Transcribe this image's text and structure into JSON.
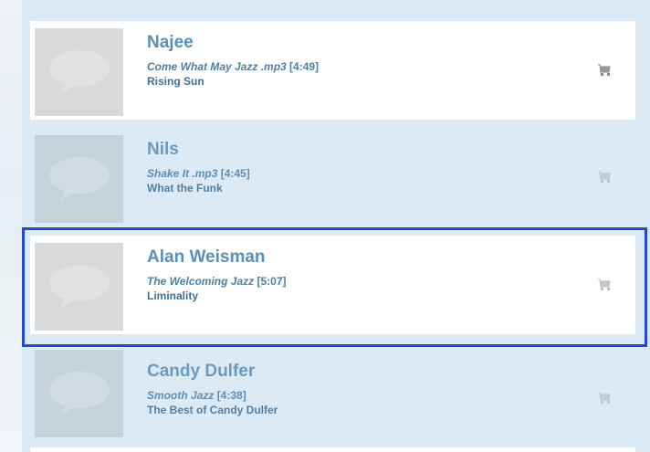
{
  "tracks": [
    {
      "artist": "Najee",
      "song": "Come What May Jazz .mp3",
      "duration": "[4:49]",
      "album": "Rising Sun",
      "thumb_icon": "speech-bubble-icon",
      "cart_icon": "cart-icon"
    },
    {
      "artist": "Nils",
      "song": "Shake It .mp3",
      "duration": "[4:45]",
      "album": "What the Funk",
      "thumb_icon": "speech-bubble-icon",
      "cart_icon": "cart-icon"
    },
    {
      "artist": "Alan Weisman",
      "song": "The Welcoming Jazz",
      "duration": "[5:07]",
      "album": "Liminality",
      "thumb_icon": "speech-bubble-icon",
      "cart_icon": "cart-icon"
    },
    {
      "artist": "Candy Dulfer",
      "song": "Smooth Jazz",
      "duration": "[4:38]",
      "album": "The Best of Candy Dulfer",
      "thumb_icon": "speech-bubble-icon",
      "cart_icon": "cart-icon"
    }
  ],
  "colors": {
    "panel": "#dbeaf4",
    "row_highlight": "#ffffff",
    "selection_border": "#2248d8",
    "artist_text": "#5a8fb8"
  }
}
